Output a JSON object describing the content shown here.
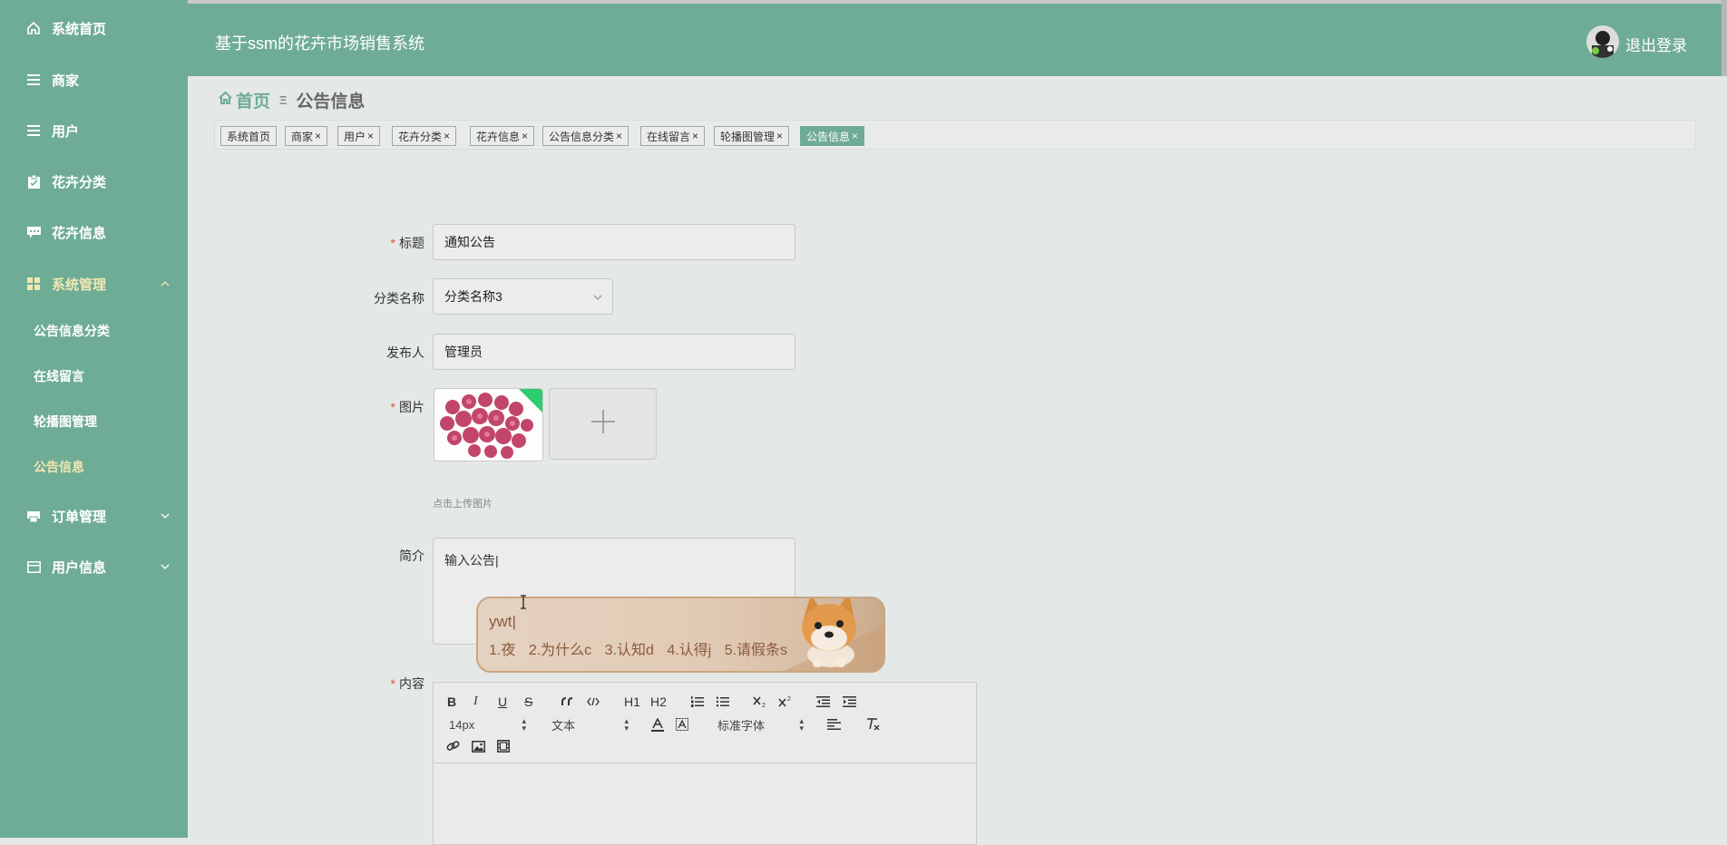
{
  "app": {
    "title": "基于ssm的花卉市场销售系统",
    "logout": "退出登录"
  },
  "colors": {
    "primary": "#6fac95",
    "active_menu": "#f1e7b3",
    "required": "#e74c3c"
  },
  "sidebar": {
    "items": [
      {
        "label": "系统首页",
        "icon": "home-icon"
      },
      {
        "label": "商家",
        "icon": "list-icon"
      },
      {
        "label": "用户",
        "icon": "list-icon"
      },
      {
        "label": "花卉分类",
        "icon": "clipboard-icon"
      },
      {
        "label": "花卉信息",
        "icon": "comment-icon"
      },
      {
        "label": "系统管理",
        "icon": "grid-icon"
      },
      {
        "label": "订单管理",
        "icon": "printer-icon"
      },
      {
        "label": "用户信息",
        "icon": "card-icon"
      }
    ],
    "submenu": [
      {
        "label": "公告信息分类"
      },
      {
        "label": "在线留言"
      },
      {
        "label": "轮播图管理"
      },
      {
        "label": "公告信息"
      }
    ]
  },
  "breadcrumb": {
    "home": "首页",
    "current": "公告信息"
  },
  "tags": [
    {
      "label": "系统首页"
    },
    {
      "label": "商家"
    },
    {
      "label": "用户"
    },
    {
      "label": "花卉分类"
    },
    {
      "label": "花卉信息"
    },
    {
      "label": "公告信息分类"
    },
    {
      "label": "在线留言"
    },
    {
      "label": "轮播图管理"
    },
    {
      "label": "公告信息"
    }
  ],
  "tag_close": "×",
  "form": {
    "title_label": "标题",
    "title_value": "通知公告",
    "category_label": "分类名称",
    "category_value": "分类名称3",
    "publisher_label": "发布人",
    "publisher_value": "管理员",
    "image_label": "图片",
    "upload_hint": "点击上传图片",
    "summary_label": "简介",
    "summary_value": "输入公告",
    "content_label": "内容"
  },
  "ime": {
    "input": "ywt",
    "candidates": [
      "1.夜",
      "2.为什么c",
      "3.认知d",
      "4.认得j",
      "5.请假条s"
    ]
  },
  "editor": {
    "font_size": "14px",
    "paragraph": "文本",
    "font_family": "标准字体",
    "buttons": {
      "bold": "B",
      "italic": "I",
      "underline": "U",
      "strike": "S",
      "h1": "H1",
      "h2": "H2"
    }
  }
}
